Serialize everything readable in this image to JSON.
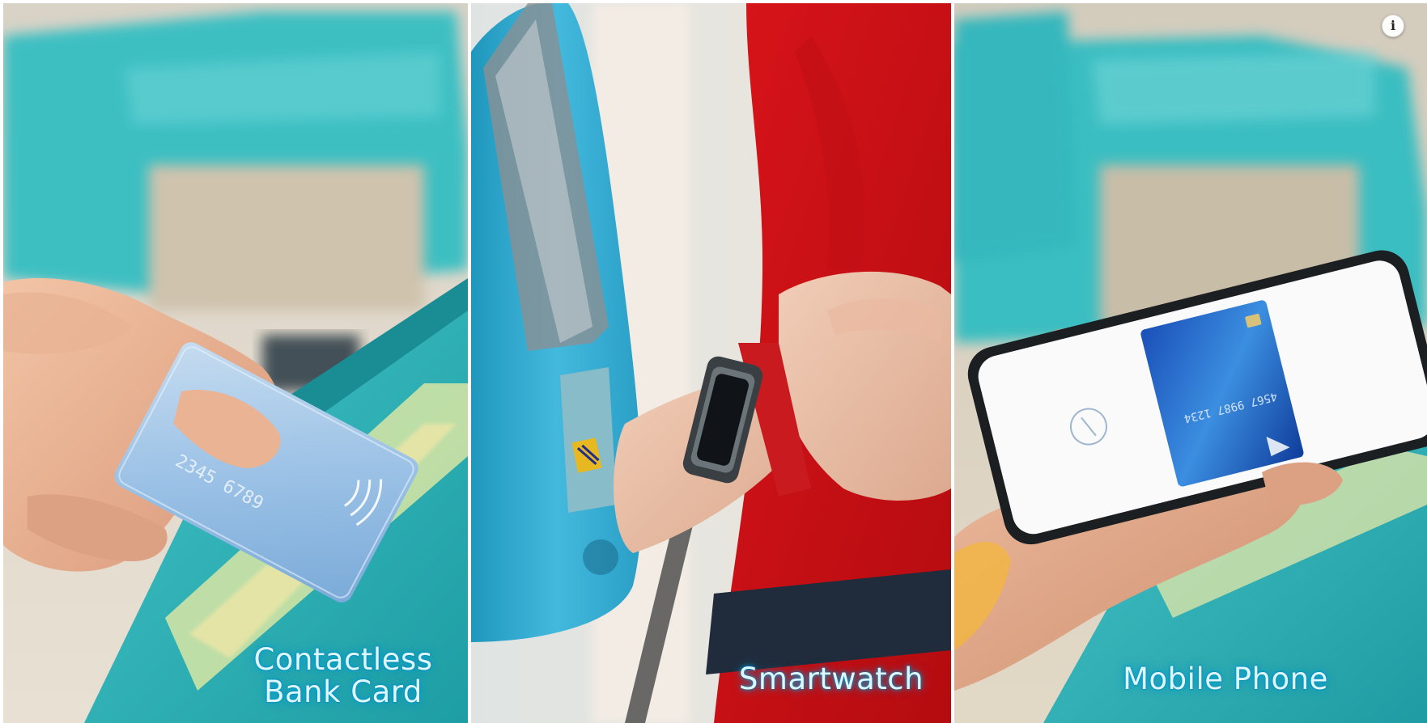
{
  "panels": [
    {
      "caption_line1": "Contactless",
      "caption_line2": "Bank Card",
      "accent": "#2fb4b8"
    },
    {
      "caption": "Smartwatch",
      "accent": "#e01818"
    },
    {
      "caption": "Mobile Phone",
      "accent": "#35b7bd"
    }
  ],
  "info_button": {
    "icon": "info-icon",
    "glyph": "i"
  },
  "caption_glow_color": "#00aadc"
}
